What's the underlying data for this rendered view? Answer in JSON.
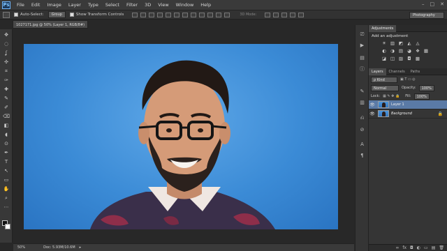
{
  "app": {
    "logo": "Ps"
  },
  "menu": [
    "File",
    "Edit",
    "Image",
    "Layer",
    "Type",
    "Select",
    "Filter",
    "3D",
    "View",
    "Window",
    "Help"
  ],
  "window_controls": [
    "–",
    "□",
    "✕"
  ],
  "options_bar": {
    "auto_select_label": "Auto-Select:",
    "auto_select_value": "Group",
    "show_transform_label": "Show Transform Controls",
    "mode_3d_label": "3D Mode:",
    "workspace": "Photography"
  },
  "document": {
    "tab_title": "1027171.jpg @ 50% (Layer 1, RGB/8#) *",
    "tab_close": "×"
  },
  "status": {
    "zoom": "50%",
    "doc_size": "Doc: 5.93M/10.6M",
    "arrow": "▸"
  },
  "tools": [
    "✥",
    "◌",
    "ʆ",
    "✣",
    "⌗",
    "✑",
    "✚",
    "✎",
    "✐",
    "⌫",
    "◧",
    "◖",
    "⊙",
    "✒",
    "T",
    "↖",
    "▭",
    "✋",
    "⌕",
    "⋯"
  ],
  "adjustments": {
    "tab": "Adjustments",
    "title": "Add an adjustment",
    "row1": [
      "☀",
      "▥",
      "◩",
      "◭",
      "◬"
    ],
    "row2": [
      "◐",
      "◑",
      "▤",
      "◕",
      "❖",
      "▦"
    ],
    "row3": [
      "◪",
      "◫",
      "▨",
      "◘",
      "▩"
    ]
  },
  "layers_panel": {
    "tabs": [
      "Layers",
      "Channels",
      "Paths"
    ],
    "kind_filter": "ρ Kind",
    "blend_mode": "Normal",
    "opacity_label": "Opacity:",
    "opacity_value": "100%",
    "lock_label": "Lock:",
    "fill_label": "Fill:",
    "fill_value": "100%",
    "layers": [
      {
        "name": "Layer 1",
        "selected": true,
        "locked": false
      },
      {
        "name": "Background",
        "selected": false,
        "locked": true
      }
    ],
    "bottom_icons": [
      "∞",
      "fx",
      "◘",
      "◐",
      "▭",
      "▤",
      "🗑"
    ]
  },
  "colors": {
    "accent_selection": "#5a7aa6",
    "canvas_blue": "#3b8bd6",
    "panel_bg": "#353535"
  }
}
